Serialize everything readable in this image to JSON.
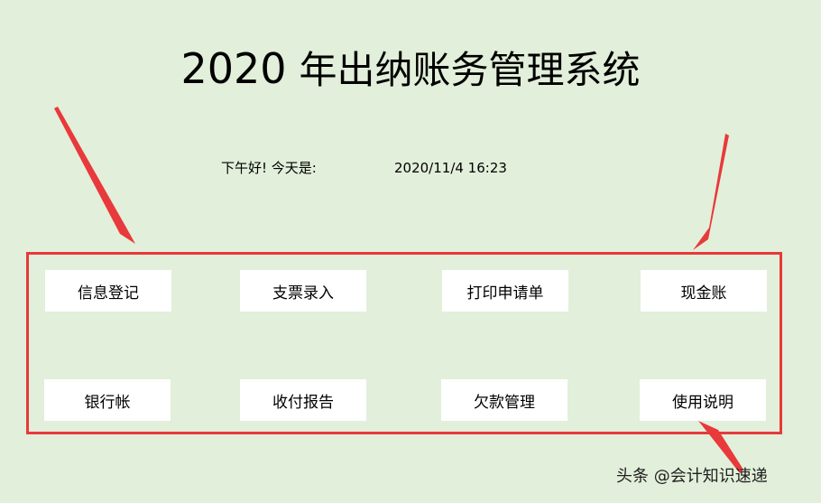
{
  "header": {
    "year": "2020",
    "title": "年出纳账务管理系统"
  },
  "status": {
    "greeting": "下午好! 今天是:",
    "datetime": "2020/11/4 16:23"
  },
  "menu": {
    "row1": [
      "信息登记",
      "支票录入",
      "打印申请单",
      "现金账"
    ],
    "row2": [
      "银行帐",
      "收付报告",
      "欠款管理",
      "使用说明"
    ]
  },
  "watermark": "头条 @会计知识速递",
  "colors": {
    "background": "#e2efda",
    "frame_border": "#e8393b",
    "button_bg": "#ffffff"
  }
}
